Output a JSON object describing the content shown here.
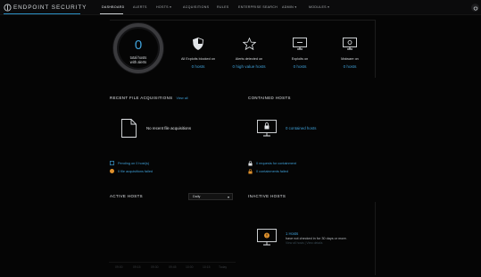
{
  "brand": {
    "name": "ENDPOINT SECURITY",
    "accent": "#3fa0d8",
    "orange": "#e0912c"
  },
  "nav": {
    "items": [
      {
        "label": "DASHBOARD",
        "active": true
      },
      {
        "label": "ALERTS"
      },
      {
        "label": "HOSTS ▾"
      },
      {
        "label": "ACQUISITIONS"
      },
      {
        "label": "RULES"
      },
      {
        "label": "ENTERPRISE SEARCH"
      },
      {
        "label": "ADMIN ▾"
      },
      {
        "label": "MODULES ▾"
      }
    ]
  },
  "summary": {
    "total": "0",
    "total_label_line1": "total hosts",
    "total_label_line2": "with alerts",
    "stats": [
      {
        "icon": "shield-icon",
        "label": "All Exploits blocked on",
        "value": "0 hosts"
      },
      {
        "icon": "star-icon",
        "label": "Alerts detected on",
        "value": "0 high value hosts"
      },
      {
        "icon": "exploit-monitor-icon",
        "label": "Exploits on",
        "value": "0 hosts"
      },
      {
        "icon": "malware-monitor-icon",
        "label": "Malware on",
        "value": "0 hosts"
      }
    ]
  },
  "file_acquisitions": {
    "title": "RECENT FILE ACQUISITIONS",
    "view_all": "View all",
    "empty": "No recent file acquisitions",
    "pending": "Pending on 0 host(s)",
    "failed": "0 file acquisitions failed"
  },
  "contained": {
    "title": "CONTAINED HOSTS",
    "count": "0 contained hosts",
    "requested": "0 requests for containment",
    "failed": "0 containments failed"
  },
  "active": {
    "title": "ACTIVE HOSTS",
    "range": "Daily",
    "ticks": [
      "09:00",
      "09:15",
      "09:30",
      "09:45",
      "10:00",
      "10:15",
      "Today"
    ]
  },
  "inactive": {
    "title": "INACTIVE HOSTS",
    "count": "1 Hosts",
    "desc": "have not checked in for 30 days or more.",
    "sub": "View all hosts  |  View details"
  }
}
